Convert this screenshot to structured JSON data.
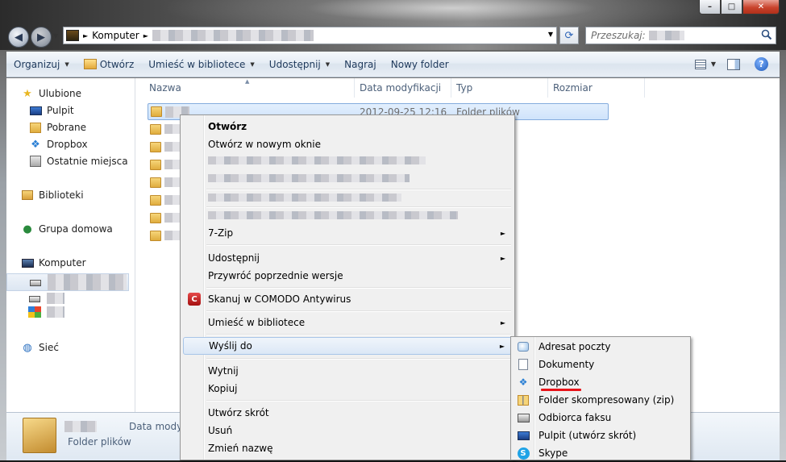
{
  "window": {
    "title": ""
  },
  "caption_buttons": {
    "minimize": "–",
    "maximize": "□",
    "close": "✕"
  },
  "address": {
    "crumb": "Komputer"
  },
  "search": {
    "placeholder": "Przeszukaj:"
  },
  "toolbar": {
    "organize": "Organizuj",
    "open": "Otwórz",
    "library": "Umieść w bibliotece",
    "share": "Udostępnij",
    "burn": "Nagraj",
    "new_folder": "Nowy folder",
    "help": "?"
  },
  "navpane": {
    "favorites": "Ulubione",
    "desktop": "Pulpit",
    "downloads": "Pobrane",
    "dropbox": "Dropbox",
    "recent": "Ostatnie miejsca",
    "libraries": "Biblioteki",
    "homegroup": "Grupa domowa",
    "computer": "Komputer",
    "network": "Sieć"
  },
  "columns": {
    "name": "Nazwa",
    "date": "Data modyfikacji",
    "type": "Typ",
    "size": "Rozmiar"
  },
  "selected_row": {
    "date": "2012-09-25 12:16",
    "type": "Folder plików"
  },
  "details": {
    "date_label": "Data modyf",
    "type": "Folder plików"
  },
  "context_menu": {
    "open": "Otwórz",
    "open_new_window": "Otwórz w nowym oknie",
    "sevenzip": "7-Zip",
    "share": "Udostępnij",
    "restore_versions": "Przywróć poprzednie wersje",
    "comodo_scan": "Skanuj w COMODO Antywirus",
    "include_library": "Umieść w bibliotece",
    "send_to": "Wyślij do",
    "cut": "Wytnij",
    "copy": "Kopiuj",
    "create_shortcut": "Utwórz skrót",
    "delete": "Usuń",
    "rename": "Zmień nazwę",
    "submenu_arrow": "►"
  },
  "send_to_menu": {
    "mail": "Adresat poczty",
    "documents": "Dokumenty",
    "dropbox": "Dropbox",
    "zip": "Folder skompresowany (zip)",
    "fax": "Odbiorca faksu",
    "desktop": "Pulpit (utwórz skrót)",
    "skype": "Skype"
  },
  "colors": {
    "accent": "#1e395b",
    "highlight": "#dbe7f6",
    "underline": "#e8141a"
  }
}
